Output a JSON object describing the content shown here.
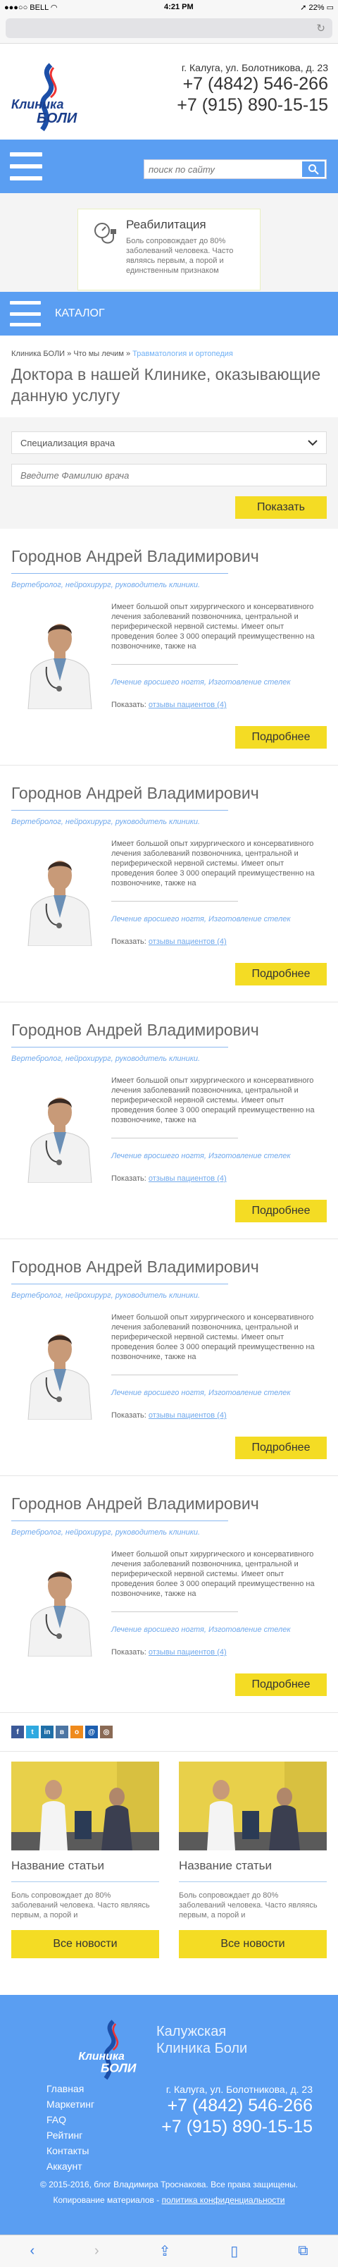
{
  "status": {
    "carrier": "BELL",
    "time": "4:21 PM",
    "battery": "22%"
  },
  "browser": {
    "refresh_icon": "refresh-icon"
  },
  "header": {
    "logo_line1": "Клиника",
    "logo_line2": "БОЛИ",
    "address": "г. Калуга, ул. Болотникова, д. 23",
    "phone1": "+7 (4842) 546-266",
    "phone2": "+7 (915) 890-15-15"
  },
  "search": {
    "placeholder": "поиск по сайту"
  },
  "rehab": {
    "title": "Реабилитация",
    "text": "Боль сопровождает до 80% заболеваний человека. Часто являясь первым, а порой и единственным признаком"
  },
  "catalog": {
    "label": "КАТАЛОГ"
  },
  "breadcrumbs": {
    "home": "Клиника БОЛИ",
    "level2": "Что мы лечим",
    "current": "Травматология и ортопедия"
  },
  "page_title": "Доктора в нашей Клинике, оказывающие данную услугу",
  "filter": {
    "select_value": "Специализация врача",
    "name_placeholder": "Введите Фамилию врача",
    "show_button": "Показать"
  },
  "doctors": [
    {
      "name": "Городнов Андрей Владимирович",
      "spec": "Вертебролог, нейрохирург, руководитель клиники.",
      "desc": "Имеет большой опыт хирургического и консервативного лечения заболеваний позвоночника, центральной и периферической нервной системы. Имеет опыт проведения более 3 000 операций преимущественно на позвоночнике, также на",
      "links": "Лечение вросшего ногтя, Изготовление стелек",
      "show_label": "Показать:",
      "reviews": "отзывы пациентов (4)",
      "more": "Подробнее"
    },
    {
      "name": "Городнов Андрей Владимирович",
      "spec": "Вертебролог, нейрохирург, руководитель клиники.",
      "desc": "Имеет большой опыт хирургического и консервативного лечения заболеваний позвоночника, центральной и периферической нервной системы. Имеет опыт проведения более 3 000 операций преимущественно на позвоночнике, также на",
      "links": "Лечение вросшего ногтя, Изготовление стелек",
      "show_label": "Показать:",
      "reviews": "отзывы пациентов (4)",
      "more": "Подробнее"
    },
    {
      "name": "Городнов Андрей Владимирович",
      "spec": "Вертебролог, нейрохирург, руководитель клиники.",
      "desc": "Имеет большой опыт хирургического и консервативного лечения заболеваний позвоночника, центральной и периферической нервной системы. Имеет опыт проведения более 3 000 операций преимущественно на позвоночнике, также на",
      "links": "Лечение вросшего ногтя, Изготовление стелек",
      "show_label": "Показать:",
      "reviews": "отзывы пациентов (4)",
      "more": "Подробнее"
    },
    {
      "name": "Городнов Андрей Владимирович",
      "spec": "Вертебролог, нейрохирург, руководитель клиники.",
      "desc": "Имеет большой опыт хирургического и консервативного лечения заболеваний позвоночника, центральной и периферической нервной системы. Имеет опыт проведения более 3 000 операций преимущественно на позвоночнике, также на",
      "links": "Лечение вросшего ногтя, Изготовление стелек",
      "show_label": "Показать:",
      "reviews": "отзывы пациентов (4)",
      "more": "Подробнее"
    },
    {
      "name": "Городнов Андрей Владимирович",
      "spec": "Вертебролог, нейрохирург, руководитель клиники.",
      "desc": "Имеет большой опыт хирургического и консервативного лечения заболеваний позвоночника, центральной и периферической нервной системы. Имеет опыт проведения более 3 000 операций преимущественно на позвоночнике, также на",
      "links": "Лечение вросшего ногтя, Изготовление стелек",
      "show_label": "Показать:",
      "reviews": "отзывы пациентов (4)",
      "more": "Подробнее"
    }
  ],
  "social": [
    {
      "icon": "facebook-icon",
      "glyph": "f",
      "color": "#3b5998"
    },
    {
      "icon": "twitter-icon",
      "glyph": "t",
      "color": "#2fa9e0"
    },
    {
      "icon": "linkedin-icon",
      "glyph": "in",
      "color": "#1f6fa8"
    },
    {
      "icon": "vk-icon",
      "glyph": "в",
      "color": "#4c75a3"
    },
    {
      "icon": "odnoklassniki-icon",
      "glyph": "о",
      "color": "#ef8a1c"
    },
    {
      "icon": "mailru-icon",
      "glyph": "@",
      "color": "#1d5fb0"
    },
    {
      "icon": "instagram-icon",
      "glyph": "◎",
      "color": "#8a6a55"
    }
  ],
  "articles": [
    {
      "title": "Название статьи",
      "text": "Боль сопровождает до 80% заболеваний человека. Часто являясь первым, а порой и",
      "button": "Все новости"
    },
    {
      "title": "Название статьи",
      "text": "Боль сопровождает до 80% заболеваний человека. Часто являясь первым, а порой и",
      "button": "Все новости"
    }
  ],
  "footer": {
    "title": "Калужская Клиника Боли",
    "menu": [
      "Главная",
      "Маркетинг",
      "FAQ",
      "Рейтинг",
      "Контакты",
      "Аккаунт"
    ],
    "address": "г. Калуга, ул. Болотникова, д. 23",
    "phone1": "+7 (4842) 546-266",
    "phone2": "+7 (915) 890-15-15",
    "copyright": "© 2015-2016, блог Владимира Троснакова. Все права защищены.",
    "copy_note": "Копирование материалов -",
    "policy": "политика конфиденциальности"
  },
  "colors": {
    "accent": "#5a9ef2",
    "button": "#f4dc24",
    "link": "#6fa8ec"
  }
}
